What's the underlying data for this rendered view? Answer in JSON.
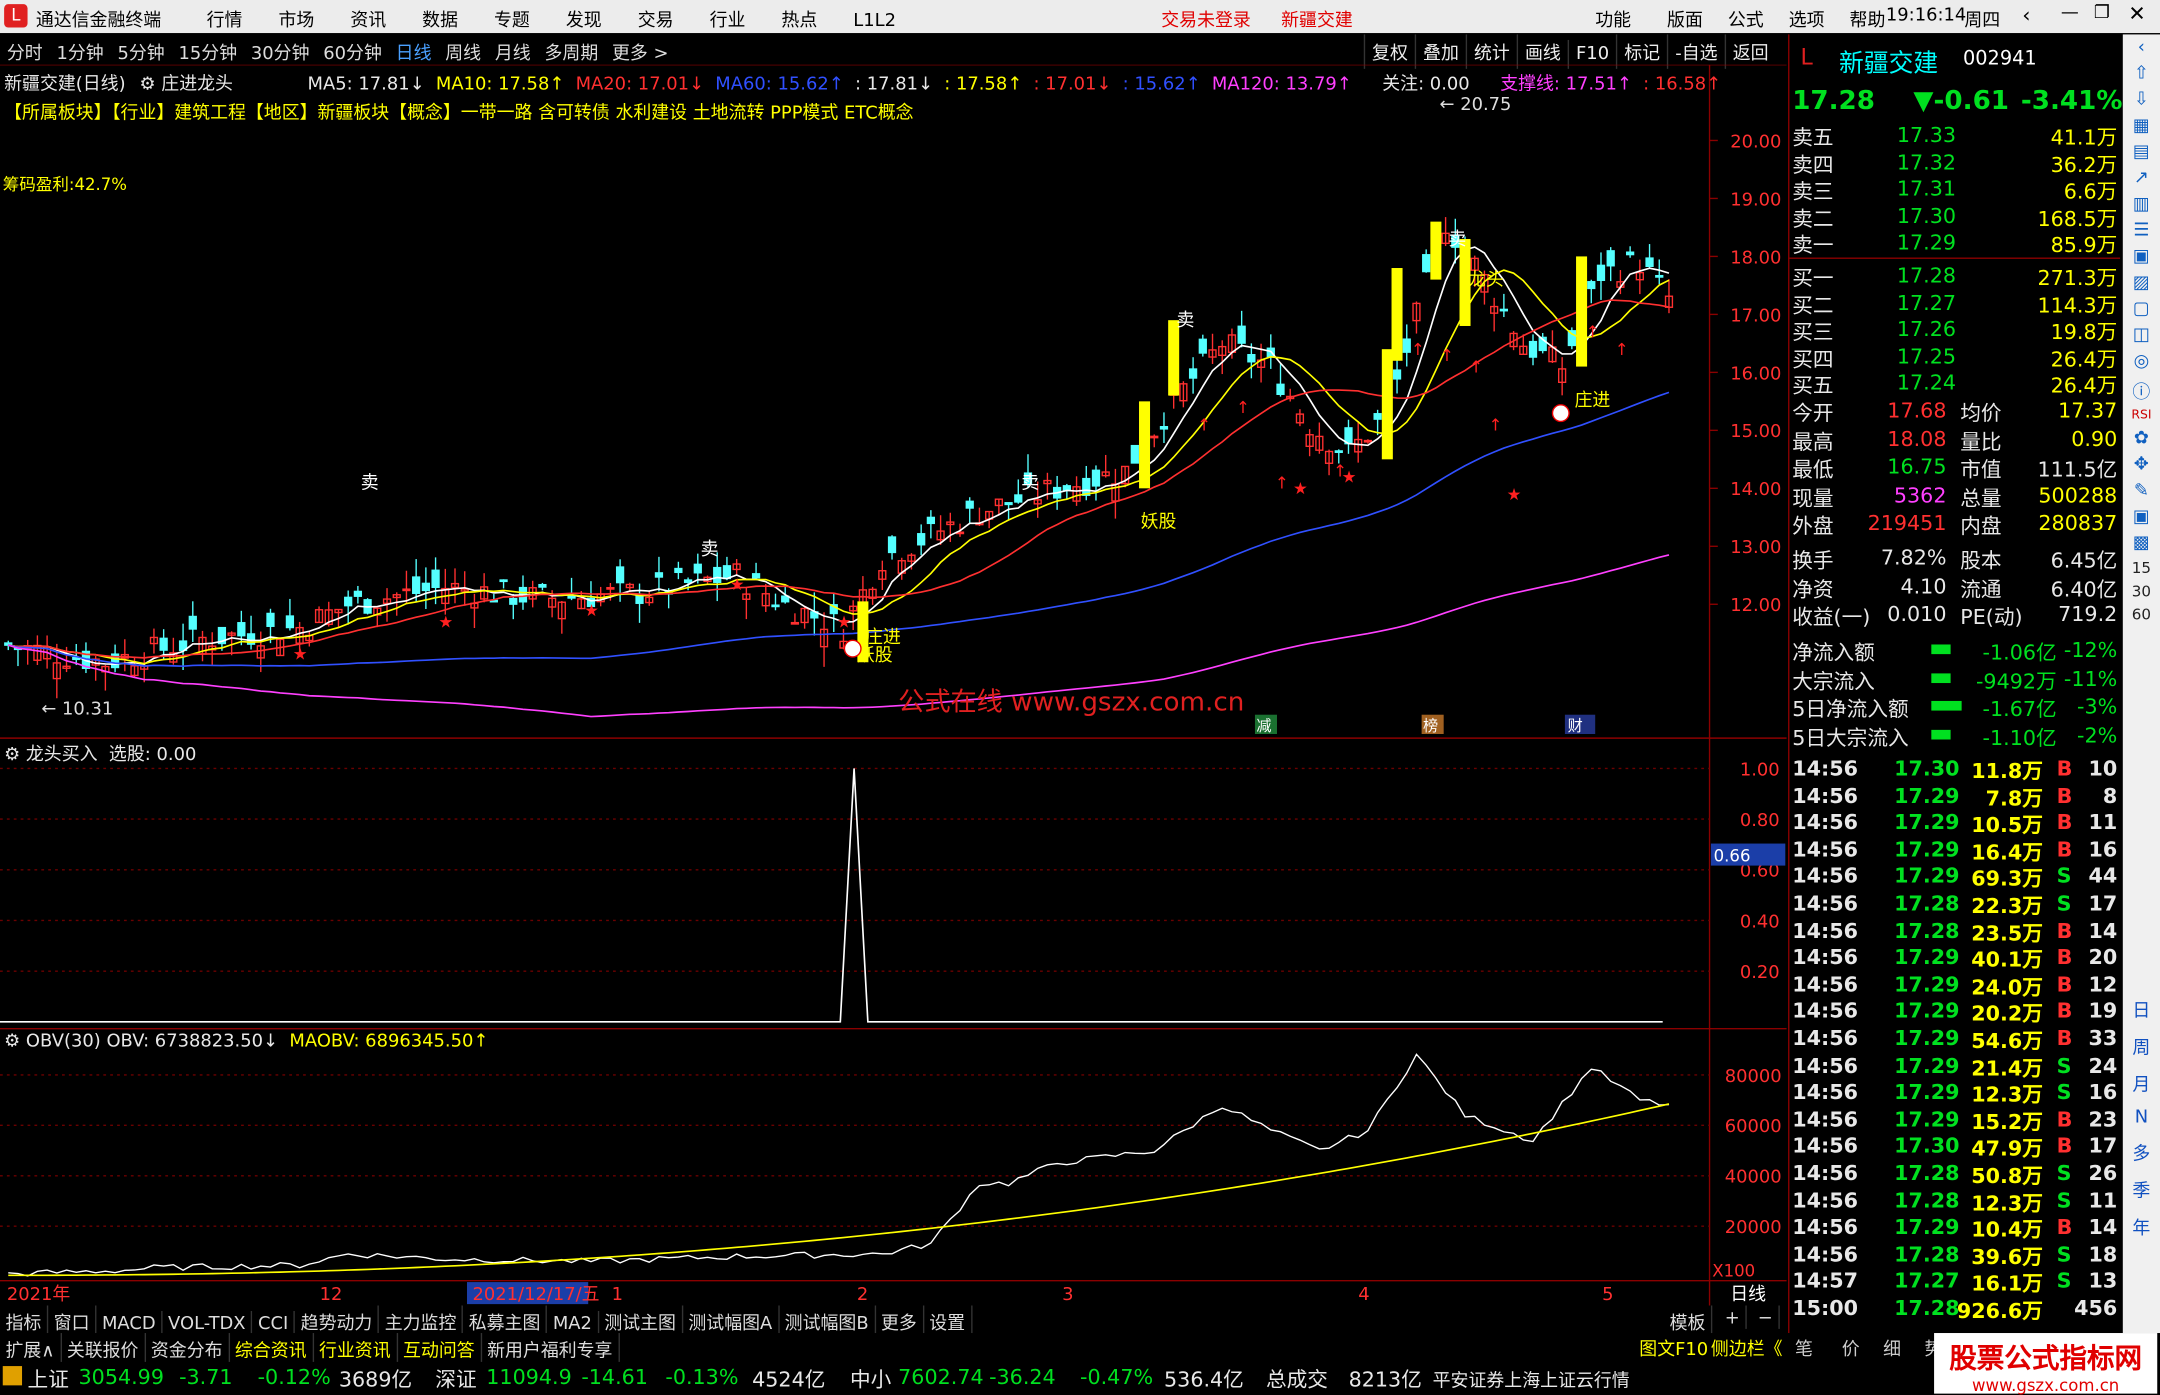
{
  "app": {
    "name": "通达信金融终端",
    "menus": [
      "行情",
      "市场",
      "资讯",
      "数据",
      "专题",
      "发现",
      "交易",
      "行业",
      "热点",
      "L1L2"
    ],
    "login": "交易未登录",
    "stock_name_center": "新疆交建",
    "right_menus": [
      "功能",
      "版面",
      "公式",
      "选项",
      "帮助"
    ],
    "time": "19:16:14",
    "weekday": "周四"
  },
  "periods": [
    "分时",
    "1分钟",
    "5分钟",
    "15分钟",
    "30分钟",
    "60分钟",
    "日线",
    "周线",
    "月线",
    "多周期",
    "更多 >"
  ],
  "active_period": "日线",
  "tools": [
    "复权",
    "叠加",
    "统计",
    "画线",
    "F10",
    "标记",
    "-自选",
    "返回"
  ],
  "ma": {
    "title": "新疆交建(日线)",
    "indicator": "庄进龙头",
    "ma5": "MA5: 17.81↓",
    "ma10": "MA10: 17.58↑",
    "ma20": "MA20: 17.01↓",
    "ma60": "MA60: 15.62↑",
    "v5": ": 17.81↓",
    ":v10": "",
    "v10": ": 17.58↑",
    "v20": ": 17.01↓",
    "v60": ": 15.62↑",
    "ma120": "MA120: 13.79↑",
    "guanzhu": "关注: 0.00",
    "zhicheng": "支撑线: 17.51↑",
    "v1658": ": 16.58↑"
  },
  "sector": "【所属板块】【行业】建筑工程【地区】新疆板块【概念】一带一路 含可转债 水利建设 土地流转 PPP模式 ETC概念",
  "chip": "筹码盈利:42.7%",
  "watermark": "公式在线  www.gszx.com.cn",
  "price_axis": [
    "20.00",
    "19.00",
    "18.00",
    "17.00",
    "16.00",
    "15.00",
    "14.00",
    "13.00",
    "12.00"
  ],
  "price_labels": {
    "high": "20.75",
    "low": "10.31"
  },
  "chart_marks": {
    "sell": "卖",
    "dragon": "龙头",
    "zhuangjin": "庄进",
    "yaogu": "妖股",
    "jian": "减",
    "bang": "榜",
    "caibao": "财"
  },
  "ind1": {
    "title": "龙头买入",
    "value": "选股: 0.00",
    "axis": [
      "1.00",
      "0.80",
      "0.60",
      "0.40",
      "0.20"
    ],
    "cursor": "0.66"
  },
  "ind2": {
    "title": "OBV(30)",
    "obv": "OBV: 6738823.50↓",
    "maobv": "MAOBV: 6896345.50↑",
    "axis": [
      "80000",
      "60000",
      "40000",
      "20000"
    ],
    "unit": "X100"
  },
  "dates": [
    "2021年",
    "12",
    "2021/12/17/五",
    "1",
    "2",
    "3",
    "4",
    "5",
    "日线"
  ],
  "stock": {
    "name": "新疆交建",
    "code": "002941",
    "price": "17.28",
    "change": "▼-0.61",
    "pct": "-3.41%"
  },
  "asks": [
    {
      "l": "卖五",
      "p": "17.33",
      "v": "41.1万"
    },
    {
      "l": "卖四",
      "p": "17.32",
      "v": "36.2万"
    },
    {
      "l": "卖三",
      "p": "17.31",
      "v": "6.6万"
    },
    {
      "l": "卖二",
      "p": "17.30",
      "v": "168.5万"
    },
    {
      "l": "卖一",
      "p": "17.29",
      "v": "85.9万"
    }
  ],
  "bids": [
    {
      "l": "买一",
      "p": "17.28",
      "v": "271.3万"
    },
    {
      "l": "买二",
      "p": "17.27",
      "v": "114.3万"
    },
    {
      "l": "买三",
      "p": "17.26",
      "v": "19.8万"
    },
    {
      "l": "买四",
      "p": "17.25",
      "v": "26.4万"
    },
    {
      "l": "买五",
      "p": "17.24",
      "v": "26.4万"
    }
  ],
  "quote": [
    {
      "a": "今开",
      "b": "17.68",
      "bc": "red",
      "c": "均价",
      "d": "17.37",
      "dc": "yellow"
    },
    {
      "a": "最高",
      "b": "18.08",
      "bc": "red",
      "c": "量比",
      "d": "0.90",
      "dc": "yellow"
    },
    {
      "a": "最低",
      "b": "16.75",
      "bc": "green",
      "c": "市值",
      "d": "111.5亿",
      "dc": "white"
    },
    {
      "a": "现量",
      "b": "5362",
      "bc": "mag",
      "c": "总量",
      "d": "500288",
      "dc": "yellow"
    },
    {
      "a": "外盘",
      "b": "219451",
      "bc": "red",
      "c": "内盘",
      "d": "280837",
      "dc": "yellow"
    }
  ],
  "fund": [
    {
      "a": "换手",
      "b": "7.82%",
      "c": "股本",
      "d": "6.45亿"
    },
    {
      "a": "净资",
      "b": "4.10",
      "c": "流通",
      "d": "6.40亿"
    },
    {
      "a": "收益(一)",
      "b": "0.010",
      "c": "PE(动)",
      "d": "719.2"
    }
  ],
  "flow": [
    {
      "a": "净流入额",
      "b": "-1.06亿",
      "c": "-12%"
    },
    {
      "a": "大宗流入",
      "b": "-9492万",
      "c": "-11%"
    },
    {
      "a": "5日净流入额",
      "b": "-1.67亿",
      "c": "-3%"
    },
    {
      "a": "5日大宗流入",
      "b": "-1.10亿",
      "c": "-2%"
    }
  ],
  "ticks": [
    {
      "t": "14:56",
      "p": "17.30",
      "v": "11.8万",
      "s": "B",
      "n": "10"
    },
    {
      "t": "14:56",
      "p": "17.29",
      "v": "7.8万",
      "s": "B",
      "n": "8"
    },
    {
      "t": "14:56",
      "p": "17.29",
      "v": "10.5万",
      "s": "B",
      "n": "11"
    },
    {
      "t": "14:56",
      "p": "17.29",
      "v": "16.4万",
      "s": "B",
      "n": "16"
    },
    {
      "t": "14:56",
      "p": "17.29",
      "v": "69.3万",
      "s": "S",
      "n": "44"
    },
    {
      "t": "14:56",
      "p": "17.28",
      "v": "22.3万",
      "s": "S",
      "n": "17"
    },
    {
      "t": "14:56",
      "p": "17.28",
      "v": "23.5万",
      "s": "B",
      "n": "14"
    },
    {
      "t": "14:56",
      "p": "17.29",
      "v": "40.1万",
      "s": "B",
      "n": "20"
    },
    {
      "t": "14:56",
      "p": "17.29",
      "v": "24.0万",
      "s": "B",
      "n": "12"
    },
    {
      "t": "14:56",
      "p": "17.29",
      "v": "20.2万",
      "s": "B",
      "n": "19"
    },
    {
      "t": "14:56",
      "p": "17.29",
      "v": "54.6万",
      "s": "B",
      "n": "33"
    },
    {
      "t": "14:56",
      "p": "17.29",
      "v": "21.4万",
      "s": "S",
      "n": "24"
    },
    {
      "t": "14:56",
      "p": "17.29",
      "v": "12.3万",
      "s": "S",
      "n": "16"
    },
    {
      "t": "14:56",
      "p": "17.29",
      "v": "15.2万",
      "s": "B",
      "n": "23"
    },
    {
      "t": "14:56",
      "p": "17.30",
      "v": "47.9万",
      "s": "B",
      "n": "17"
    },
    {
      "t": "14:56",
      "p": "17.28",
      "v": "50.8万",
      "s": "S",
      "n": "26"
    },
    {
      "t": "14:56",
      "p": "17.28",
      "v": "12.3万",
      "s": "S",
      "n": "11"
    },
    {
      "t": "14:56",
      "p": "17.29",
      "v": "10.4万",
      "s": "B",
      "n": "14"
    },
    {
      "t": "14:56",
      "p": "17.28",
      "v": "39.6万",
      "s": "S",
      "n": "18"
    },
    {
      "t": "14:57",
      "p": "17.27",
      "v": "16.1万",
      "s": "S",
      "n": "13"
    },
    {
      "t": "15:00",
      "p": "17.28",
      "v": "926.6万",
      "s": "",
      "n": "456"
    }
  ],
  "bottom_tabs": [
    "指标",
    "窗口",
    "MACD",
    "VOL-TDX",
    "CCI",
    "趋势动力",
    "主力监控",
    "私募主图",
    "MA2",
    "测试主图",
    "测试幅图A",
    "测试幅图B",
    "更多",
    "设置"
  ],
  "bottom_right": [
    "模板",
    "+",
    "−"
  ],
  "ext_tabs": [
    "扩展∧",
    "关联报价",
    "资金分布",
    "综合资讯",
    "行业资讯",
    "互动问答",
    "新用户福利专享"
  ],
  "ext_right": [
    "图文F10",
    "侧边栏《",
    "笔",
    "价",
    "细",
    "势"
  ],
  "index": [
    {
      "n": "上证",
      "v": "3054.99",
      "c": "-3.71",
      "p": "-0.12%",
      "a": "3689亿"
    },
    {
      "n": "深证",
      "v": "11094.9",
      "c": "-14.61",
      "p": "-0.13%",
      "a": "4524亿"
    },
    {
      "n": "中小",
      "v": "7602.74",
      "c": "-36.24",
      "p": "-0.47%",
      "a": "536.4亿"
    }
  ],
  "turnover": {
    "label": "总成交",
    "value": "8213亿"
  },
  "broker": "平安证券上海上证云行情",
  "logo": {
    "line1": "股票公式指标网",
    "line2": "www.gszx.com.cn"
  },
  "side_icons": [
    "日",
    "周",
    "月",
    "N",
    "多",
    "季",
    "年"
  ]
}
